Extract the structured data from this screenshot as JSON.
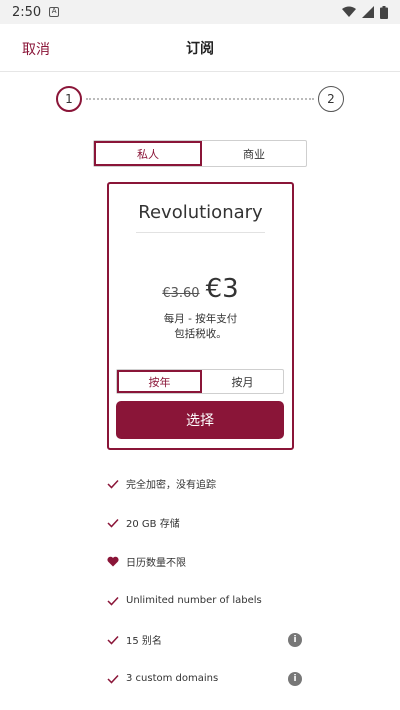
{
  "status_bar": {
    "time": "2:50"
  },
  "app_bar": {
    "cancel_label": "取消",
    "title": "订阅"
  },
  "stepper": {
    "step1": "1",
    "step2": "2",
    "current": 1
  },
  "account_type": {
    "options": [
      "私人",
      "商业"
    ],
    "selected": "私人"
  },
  "plan": {
    "name": "Revolutionary",
    "old_price": "€3.60",
    "price": "€3",
    "note_line1": "每月 - 按年支付",
    "note_line2": "包括税收。"
  },
  "billing_cycle": {
    "options": [
      "按年",
      "按月"
    ],
    "selected": "按年"
  },
  "select_button_label": "选择",
  "colors": {
    "accent": "#8a1538"
  },
  "features": [
    {
      "icon": "check-icon",
      "text": "完全加密，没有追踪",
      "info": false
    },
    {
      "icon": "check-icon",
      "text": "20 GB 存储",
      "info": false
    },
    {
      "icon": "heart-icon",
      "text": "日历数量不限",
      "info": false
    },
    {
      "icon": "check-icon",
      "text": "Unlimited number of labels",
      "info": false
    },
    {
      "icon": "check-icon",
      "text": "15 别名",
      "info": true
    },
    {
      "icon": "check-icon",
      "text": "3 custom domains",
      "info": true
    }
  ]
}
